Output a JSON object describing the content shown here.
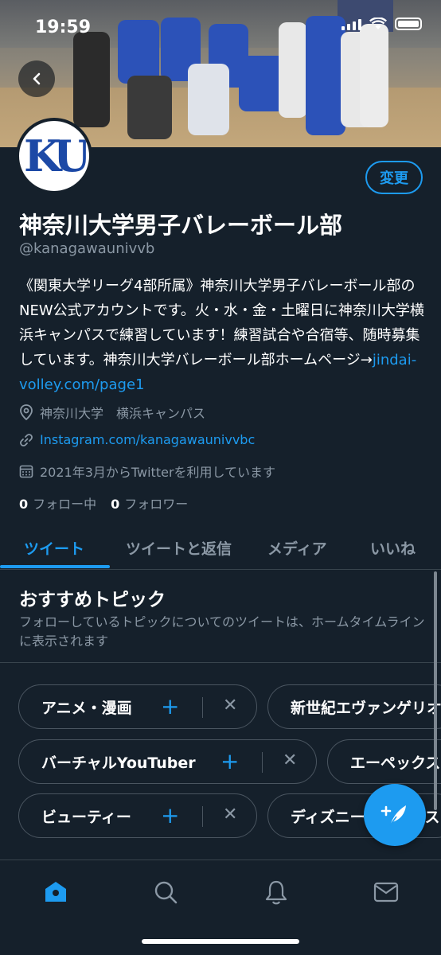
{
  "status_bar": {
    "time": "19:59"
  },
  "profile": {
    "name": "神奈川大学男子バレーボール部",
    "handle": "@kanagawaunivvb",
    "avatar_text": "KU",
    "edit_label": "変更",
    "bio_text": "《関東大学リーグ4部所属》神奈川大学男子バレーボール部のNEW公式アカウントです。火・水・金・土曜日に神奈川大学横浜キャンパスで練習しています！練習試合や合宿等、随時募集しています。神奈川大学バレーボール部ホームページ→",
    "bio_link": "jindai-volley.com/page1",
    "location": "神奈川大学　横浜キャンパス",
    "website": "Instagram.com/kanagawaunivvbc",
    "joined": "2021年3月からTwitterを利用しています",
    "following_count": "0",
    "following_label": "フォロー中",
    "followers_count": "0",
    "followers_label": "フォロワー"
  },
  "tabs": [
    {
      "label": "ツイート",
      "active": true
    },
    {
      "label": "ツイートと返信",
      "active": false
    },
    {
      "label": "メディア",
      "active": false
    },
    {
      "label": "いいね",
      "active": false
    }
  ],
  "topics": {
    "title": "おすすめトピック",
    "description": "フォローしているトピックについてのツイートは、ホームタイムラインに表示されます",
    "rows": [
      [
        "アニメ・漫画",
        "新世紀エヴァンゲリオン"
      ],
      [
        "バーチャルYouTuber",
        "エーペックスレジェンズ"
      ],
      [
        "ビューティー",
        "ディズニープリンセス"
      ]
    ]
  },
  "icons": {
    "back": "back-arrow-icon",
    "location": "location-pin-icon",
    "link": "link-icon",
    "calendar": "calendar-icon",
    "compose": "compose-tweet-icon",
    "home": "home-icon",
    "search": "search-icon",
    "notifications": "bell-icon",
    "messages": "mail-icon"
  },
  "colors": {
    "background": "#15202b",
    "accent": "#1d9bf0",
    "muted": "#8b98a5",
    "border": "#38444d"
  }
}
